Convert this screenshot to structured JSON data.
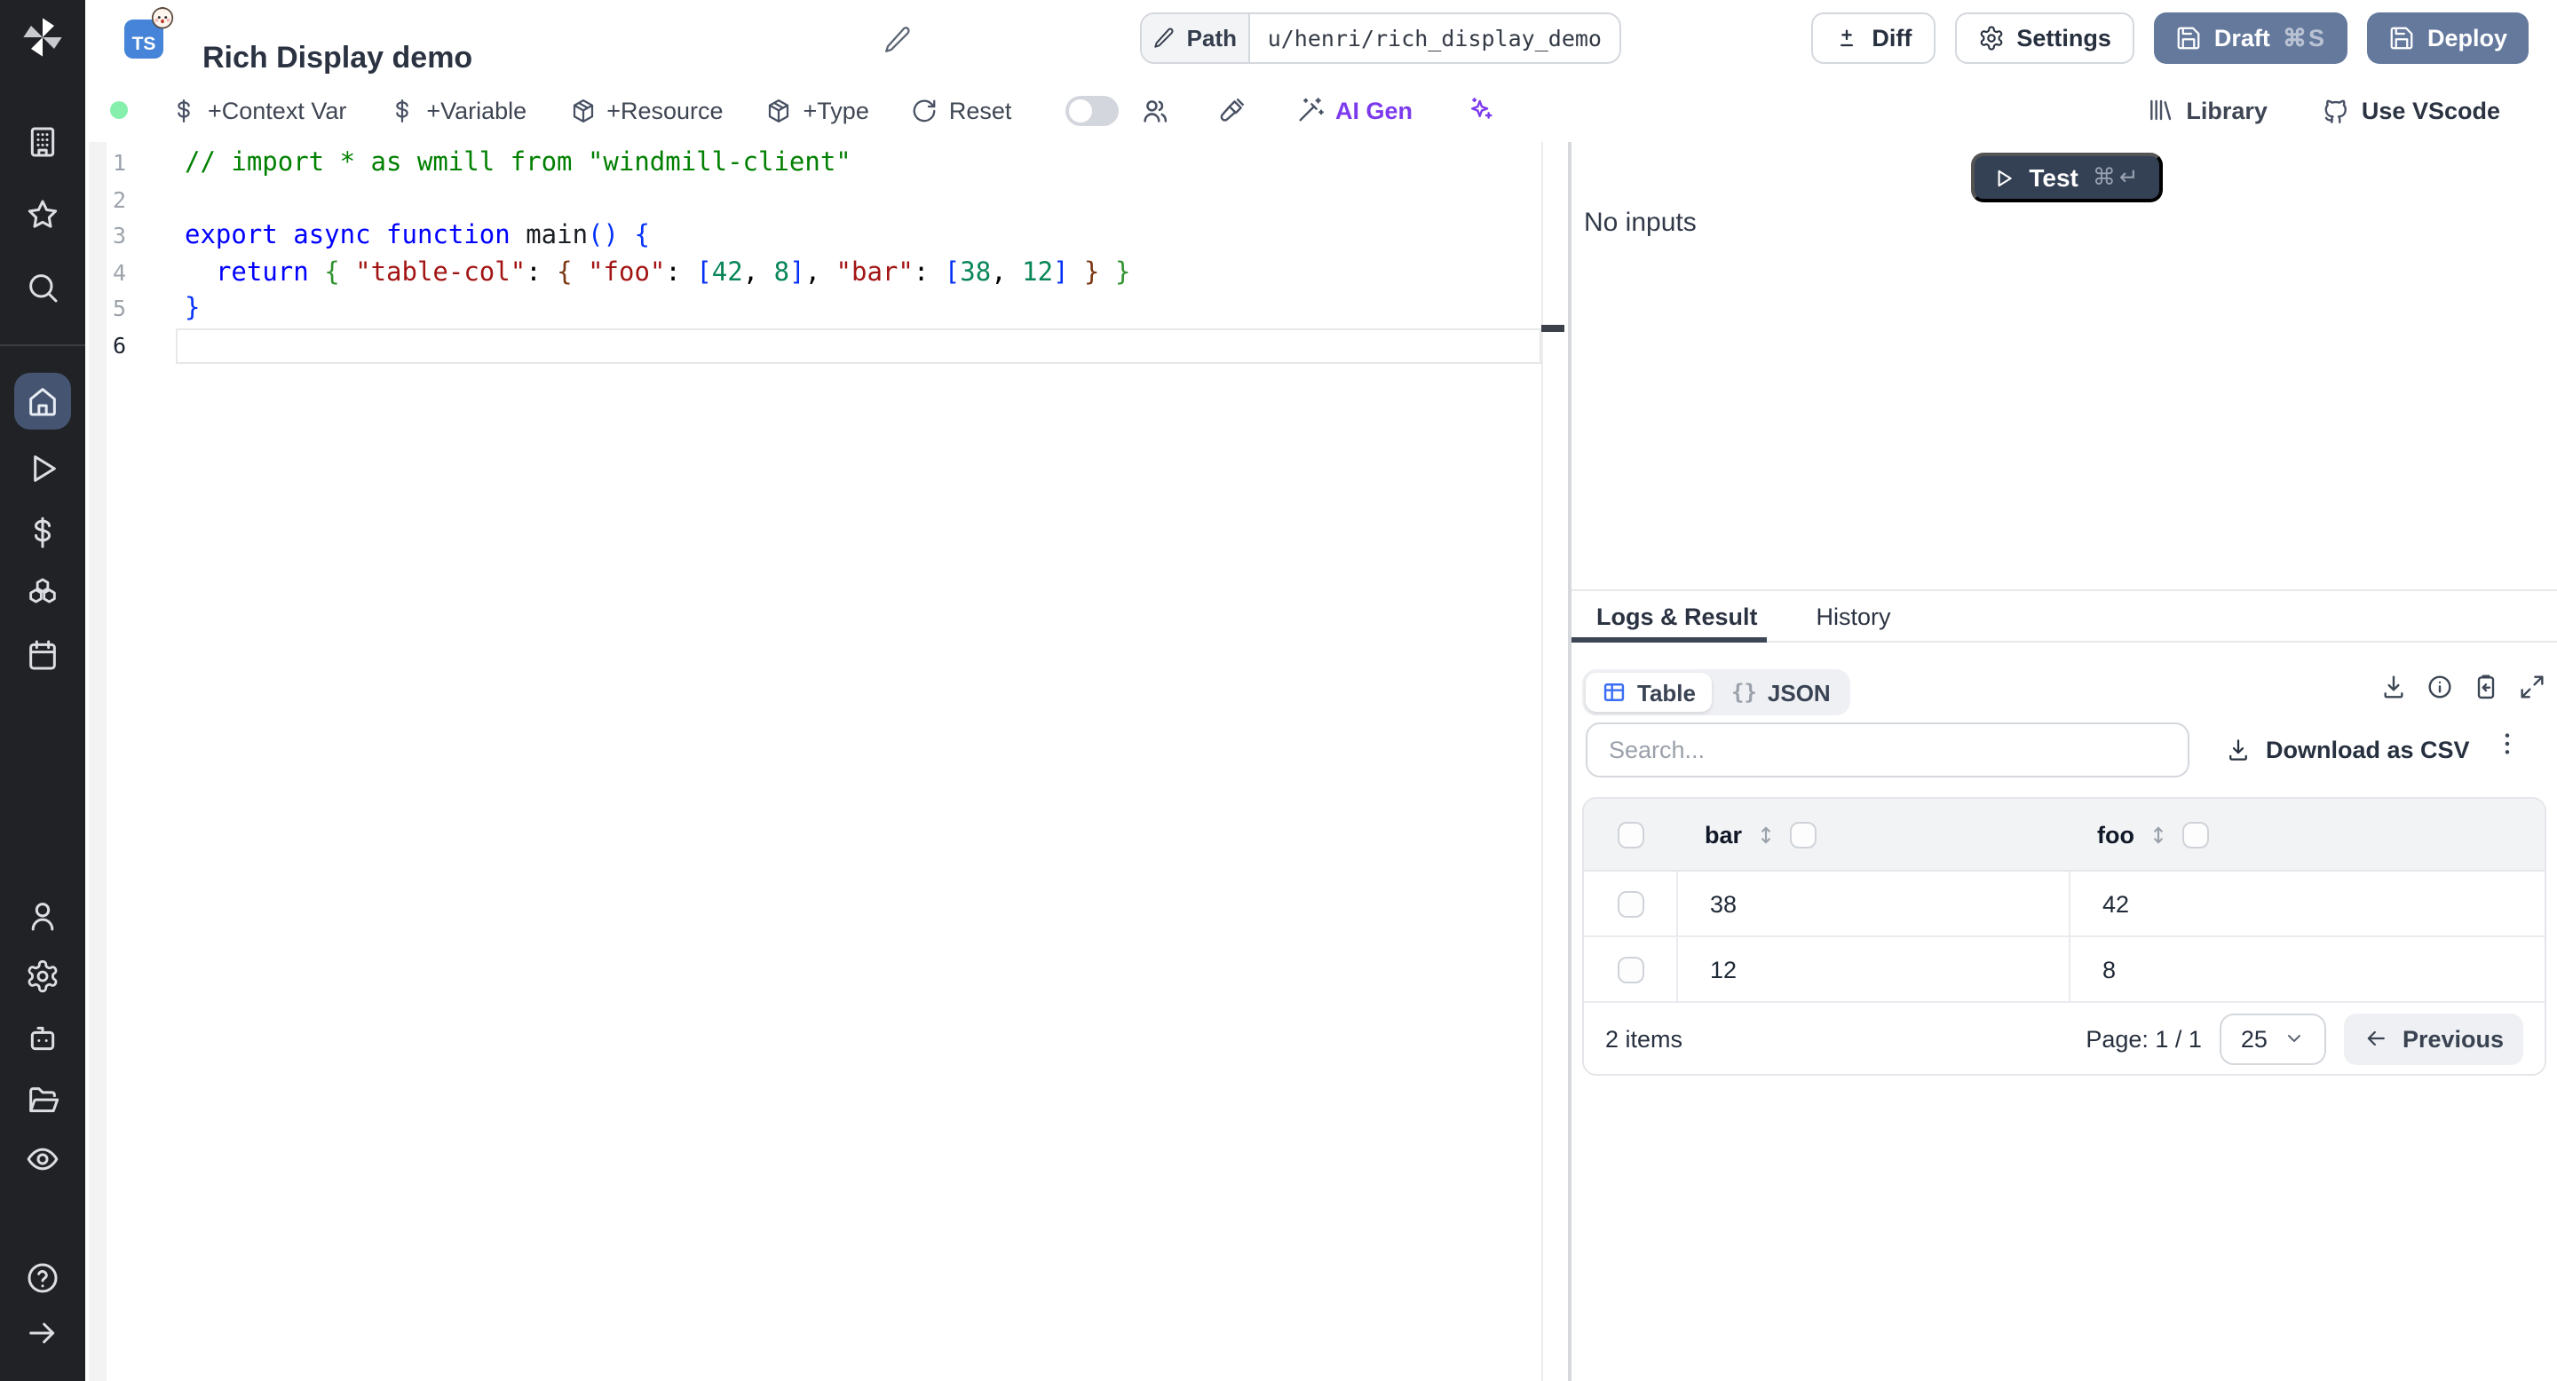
{
  "header": {
    "badge_lang": "TS",
    "title": "Rich Display demo",
    "path_label": "Path",
    "path_value": "u/henri/rich_display_demo",
    "diff_label": "Diff",
    "settings_label": "Settings",
    "draft_label": "Draft",
    "draft_shortcut": "⌘S",
    "deploy_label": "Deploy"
  },
  "toolbar": {
    "context_var": "+Context Var",
    "variable": "+Variable",
    "resource": "+Resource",
    "type": "+Type",
    "reset": "Reset",
    "ai_gen": "AI Gen",
    "library": "Library",
    "vscode": "Use VScode"
  },
  "editor": {
    "active_line": 6,
    "lines": [
      [
        {
          "c": "cm",
          "t": "// import * as wmill from \"windmill-client\""
        }
      ],
      [],
      [
        {
          "c": "kw",
          "t": "export"
        },
        {
          "c": "p",
          "t": " "
        },
        {
          "c": "kw",
          "t": "async"
        },
        {
          "c": "p",
          "t": " "
        },
        {
          "c": "kw",
          "t": "function"
        },
        {
          "c": "p",
          "t": " "
        },
        {
          "c": "fn",
          "t": "main"
        },
        {
          "c": "b1",
          "t": "()"
        },
        {
          "c": "p",
          "t": " "
        },
        {
          "c": "b1",
          "t": "{"
        }
      ],
      [
        {
          "c": "p",
          "t": "  "
        },
        {
          "c": "kw",
          "t": "return"
        },
        {
          "c": "p",
          "t": " "
        },
        {
          "c": "b2",
          "t": "{"
        },
        {
          "c": "p",
          "t": " "
        },
        {
          "c": "str",
          "t": "\"table-col\""
        },
        {
          "c": "p",
          "t": ": "
        },
        {
          "c": "b3",
          "t": "{"
        },
        {
          "c": "p",
          "t": " "
        },
        {
          "c": "str",
          "t": "\"foo\""
        },
        {
          "c": "p",
          "t": ": "
        },
        {
          "c": "b1",
          "t": "["
        },
        {
          "c": "num",
          "t": "42"
        },
        {
          "c": "p",
          "t": ", "
        },
        {
          "c": "num",
          "t": "8"
        },
        {
          "c": "b1",
          "t": "]"
        },
        {
          "c": "p",
          "t": ", "
        },
        {
          "c": "str",
          "t": "\"bar\""
        },
        {
          "c": "p",
          "t": ": "
        },
        {
          "c": "b1",
          "t": "["
        },
        {
          "c": "num",
          "t": "38"
        },
        {
          "c": "p",
          "t": ", "
        },
        {
          "c": "num",
          "t": "12"
        },
        {
          "c": "b1",
          "t": "]"
        },
        {
          "c": "p",
          "t": " "
        },
        {
          "c": "b3",
          "t": "}"
        },
        {
          "c": "p",
          "t": " "
        },
        {
          "c": "b2",
          "t": "}"
        }
      ],
      [
        {
          "c": "b1",
          "t": "}"
        }
      ],
      []
    ]
  },
  "run": {
    "test_label": "Test",
    "test_shortcut": "⌘↵",
    "no_inputs": "No inputs"
  },
  "result": {
    "tab_logs": "Logs & Result",
    "tab_history": "History",
    "view_table": "Table",
    "view_json": "JSON",
    "json_glyph": "{}",
    "search_placeholder": "Search...",
    "download_csv": "Download as CSV",
    "table": {
      "columns": [
        "bar",
        "foo"
      ],
      "rows": [
        [
          "38",
          "42"
        ],
        [
          "12",
          "8"
        ]
      ]
    },
    "footer": {
      "items": "2 items",
      "page": "Page: 1 / 1",
      "page_size": "25",
      "previous": "Previous"
    }
  },
  "icons": {
    "sidebar": [
      "windmill-logo",
      "building",
      "star",
      "search",
      "home",
      "play",
      "dollar-sign",
      "boxes",
      "calendar",
      "user",
      "settings-gear",
      "bot",
      "folder-open",
      "eye",
      "help-circle",
      "arrow-right"
    ],
    "header": [
      "pencil",
      "diff-plus-minus",
      "gear",
      "save"
    ],
    "toolbar": [
      "status-dot",
      "dollar-sign",
      "package",
      "rotate-reset",
      "users",
      "paintbrush",
      "wand-sparkles",
      "sparkles",
      "library",
      "github-cat"
    ],
    "result": [
      "play",
      "table-grid",
      "braces",
      "download",
      "info",
      "clipboard-copy",
      "expand",
      "kebab",
      "sort-updown",
      "checkbox",
      "chevron-down",
      "arrow-left"
    ]
  },
  "colors": {
    "accent_blue": "#3b6ef6",
    "brand_violet": "#7c3aed",
    "deploy_blue": "#65799d",
    "test_navy": "#344054",
    "sidebar_bg": "#212226",
    "sidebar_active": "#445471",
    "status_green": "#86efac",
    "ts_badge_blue": "#4584d8"
  }
}
